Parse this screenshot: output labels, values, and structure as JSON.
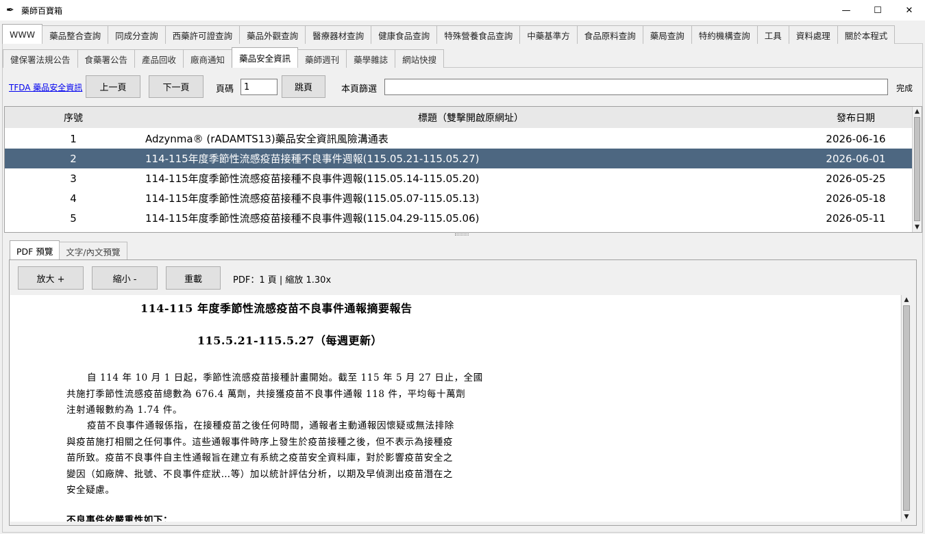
{
  "window": {
    "title": "藥師百寶箱",
    "controls": {
      "minimize": "—",
      "maximize": "☐",
      "close": "✕"
    }
  },
  "main_tabs": [
    "WWW",
    "藥品整合查詢",
    "同成分查詢",
    "西藥許可證查詢",
    "藥品外觀查詢",
    "醫療器材查詢",
    "健康食品查詢",
    "特殊營養食品查詢",
    "中藥基準方",
    "食品原料查詢",
    "藥局查詢",
    "特約機構查詢",
    "工具",
    "資料處理",
    "關於本程式"
  ],
  "sub_tabs": [
    "健保署法規公告",
    "食藥署公告",
    "產品回收",
    "廠商通知",
    "藥品安全資訊",
    "藥師週刊",
    "藥學雜誌",
    "網站快搜"
  ],
  "toolbar": {
    "source_link": "TFDA 藥品安全資訊",
    "prev_label": "上一頁",
    "next_label": "下一頁",
    "page_label": "頁碼",
    "page_value": "1",
    "jump_label": "跳頁",
    "filter_label": "本頁篩選",
    "filter_value": "",
    "status": "完成"
  },
  "table": {
    "headers": [
      "序號",
      "標題（雙擊開啟原網址）",
      "發布日期"
    ],
    "rows": [
      {
        "no": "1",
        "title": "Adzynma® (rADAMTS13)藥品安全資訊風險溝通表",
        "date": "2026-06-16"
      },
      {
        "no": "2",
        "title": "114-115年度季節性流感疫苗接種不良事件週報(115.05.21-115.05.27)",
        "date": "2026-06-01"
      },
      {
        "no": "3",
        "title": "114-115年度季節性流感疫苗接種不良事件週報(115.05.14-115.05.20)",
        "date": "2026-05-25"
      },
      {
        "no": "4",
        "title": "114-115年度季節性流感疫苗接種不良事件週報(115.05.07-115.05.13)",
        "date": "2026-05-18"
      },
      {
        "no": "5",
        "title": "114-115年度季節性流感疫苗接種不良事件週報(115.04.29-115.05.06)",
        "date": "2026-05-11"
      }
    ],
    "selected_index": 1
  },
  "preview_tabs": [
    "PDF 預覽",
    "文字/內文預覽"
  ],
  "pdf_toolbar": {
    "zoom_in": "放大 +",
    "zoom_out": "縮小 -",
    "reload": "重載",
    "info": "PDF：1 頁 | 縮放 1.30x"
  },
  "document": {
    "title": "114-115 年度季節性流感疫苗不良事件通報摘要報告",
    "subtitle": "115.5.21-115.5.27（每週更新）",
    "para1": [
      "自 114 年 10 月 1 日起，季節性流感疫苗接種計畫開始。截至 115 年 5 月 27 日止，全國",
      "共施打季節性流感疫苗總數為 676.4 萬劑，共接獲疫苗不良事件通報 118 件，平均每十萬劑",
      "注射通報數約為 1.74 件。"
    ],
    "para2": [
      "疫苗不良事件通報係指，在接種疫苗之後任何時間，通報者主動通報因懷疑或無法排除",
      "與疫苗施打相關之任何事件。這些通報事件時序上發生於疫苗接種之後，但不表示為接種疫",
      "苗所致。疫苗不良事件自主性通報旨在建立有系統之疫苗安全資料庫，對於影響疫苗安全之",
      "變因（如廠牌、批號、不良事件症狀…等）加以統計評估分析，以期及早偵測出疫苗潛在之",
      "安全疑慮。"
    ],
    "para3": "不良事件依嚴重性如下："
  }
}
